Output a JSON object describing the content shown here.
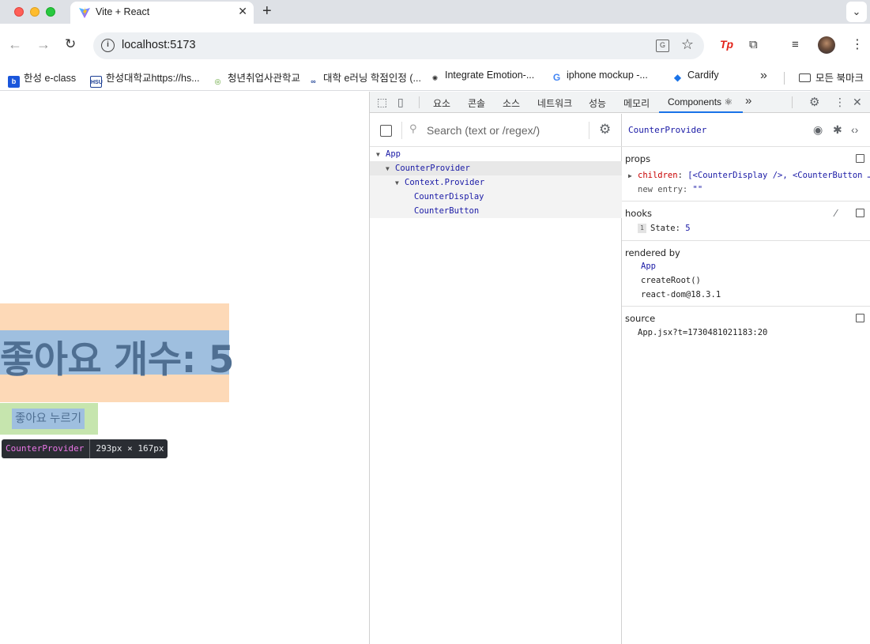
{
  "browser": {
    "tab_title": "Vite + React",
    "tab_close": "✕",
    "new_tab": "+",
    "tab_menu": "⌄",
    "url": "localhost:5173",
    "info_glyph": "i",
    "translate_glyph": "G",
    "star_glyph": "☆",
    "back_glyph": "←",
    "forward_glyph": "→",
    "reload_glyph": "↻",
    "ext_tp": "Tp",
    "puzzle_glyph": "⧉",
    "media_glyph": "≡",
    "kebab_glyph": "⋮"
  },
  "bookmarks": {
    "items": [
      {
        "label": "한성 e-class",
        "icon": "e-class-icon",
        "color": "#1a56db"
      },
      {
        "label": "한성대학교https://hs...",
        "icon": "hsu-icon",
        "color": "#1c3f94"
      },
      {
        "label": "청년취업사관학교",
        "icon": "youth-academy-icon",
        "color": "#5aa02c"
      },
      {
        "label": "대학 e러닝 학점인정 (...",
        "icon": "elearning-icon",
        "color": "#2b4c9b"
      },
      {
        "label": "Integrate Emotion-...",
        "icon": "openai-icon",
        "color": "#333333"
      },
      {
        "label": "iphone mockup -...",
        "icon": "google-icon",
        "color": "#4285f4"
      },
      {
        "label": "Cardify",
        "icon": "cardify-icon",
        "color": "#1a73e8"
      }
    ],
    "more_glyph": "»",
    "all_bookmarks": "모든 북마크"
  },
  "page": {
    "like_count_label": "좋아요 개수: 5",
    "like_button_label": "좋아요 누르기",
    "tooltip_component": "CounterProvider",
    "tooltip_size": "293px × 167px"
  },
  "devtools": {
    "tabs": [
      "요소",
      "콘솔",
      "소스",
      "네트워크",
      "성능",
      "메모리",
      "Components ⚛"
    ],
    "overflow": "»",
    "search_placeholder": "Search (text or /regex/)",
    "tree": [
      {
        "label": "App",
        "depth": 0,
        "caret": "▼"
      },
      {
        "label": "CounterProvider",
        "depth": 1,
        "caret": "▼"
      },
      {
        "label": "Context.Provider",
        "depth": 2,
        "caret": "▼"
      },
      {
        "label": "CounterDisplay",
        "depth": 3,
        "caret": ""
      },
      {
        "label": "CounterButton",
        "depth": 3,
        "caret": ""
      }
    ],
    "selected_component": "CounterProvider",
    "props": {
      "title": "props",
      "children_key": "children",
      "children_value": "[<CounterDisplay />, <CounterButton …",
      "new_entry_key": "new entry:",
      "new_entry_value": "\"\""
    },
    "hooks": {
      "title": "hooks",
      "index": "1",
      "key": "State:",
      "value": "5"
    },
    "rendered_by": {
      "title": "rendered by",
      "items": [
        "App",
        "createRoot()",
        "react-dom@18.3.1"
      ]
    },
    "source": {
      "title": "source",
      "value": "App.jsx?t=1730481021183:20"
    }
  },
  "colors": {
    "highlight_margin": "#fdd9b7",
    "highlight_content": "#9fbfdf",
    "highlight_button_margin": "#c6e5ae",
    "component_name": "#1a1aa6",
    "prop_key": "#c80000"
  }
}
